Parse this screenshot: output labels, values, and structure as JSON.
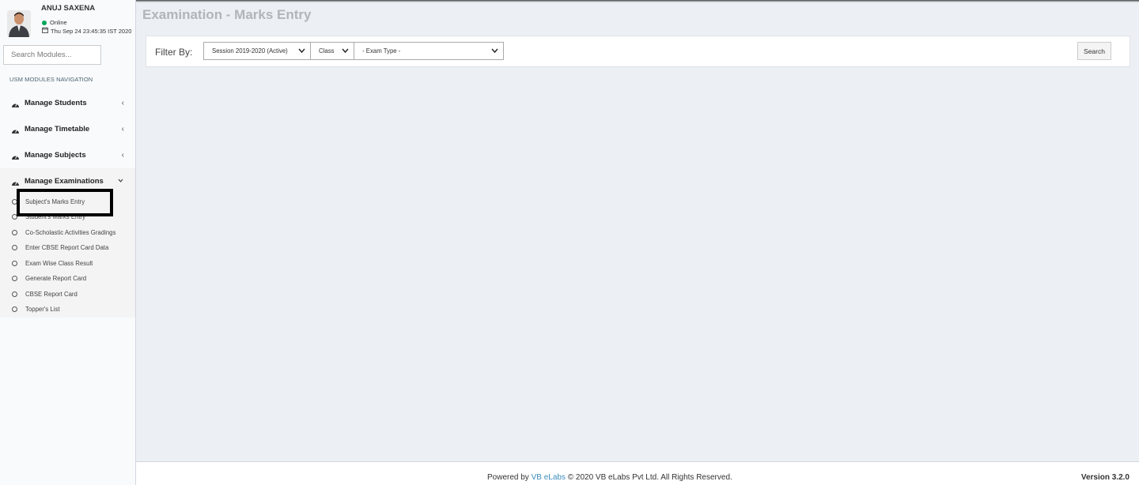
{
  "user": {
    "name": "ANUJ SAXENA",
    "status": "Online",
    "datetime": "Thu Sep 24 23:45:35 IST 2020"
  },
  "sidebar": {
    "search_placeholder": "Search Modules...",
    "nav_header": "USM MODULES NAVIGATION",
    "items": [
      {
        "label": "Manage Students"
      },
      {
        "label": "Manage Timetable"
      },
      {
        "label": "Manage Subjects"
      },
      {
        "label": "Manage Examinations"
      }
    ],
    "submenu": [
      {
        "label": "Subject's Marks Entry"
      },
      {
        "label": "Student's Marks Entry"
      },
      {
        "label": "Co-Scholastic Activities Gradings"
      },
      {
        "label": "Enter CBSE Report Card Data"
      },
      {
        "label": "Exam Wise Class Result"
      },
      {
        "label": "Generate Report Card"
      },
      {
        "label": "CBSE Report Card"
      },
      {
        "label": "Topper's List"
      }
    ]
  },
  "page": {
    "title": "Examination - Marks Entry"
  },
  "filter": {
    "label": "Filter By:",
    "session": "Session 2019-2020 (Active)",
    "class": "Class",
    "exam_type": "- Exam Type -",
    "search_button": "Search"
  },
  "footer": {
    "powered_by": "Powered by",
    "link": "VB eLabs",
    "copyright": "© 2020 VB eLabs Pvt Ltd. All Rights Reserved.",
    "version": "Version 3.2.0"
  },
  "colors": {
    "sidebar_bg": "#f9fafc",
    "content_bg": "#ecf0f5",
    "link": "#3c8dbc",
    "online": "#00a65a"
  }
}
